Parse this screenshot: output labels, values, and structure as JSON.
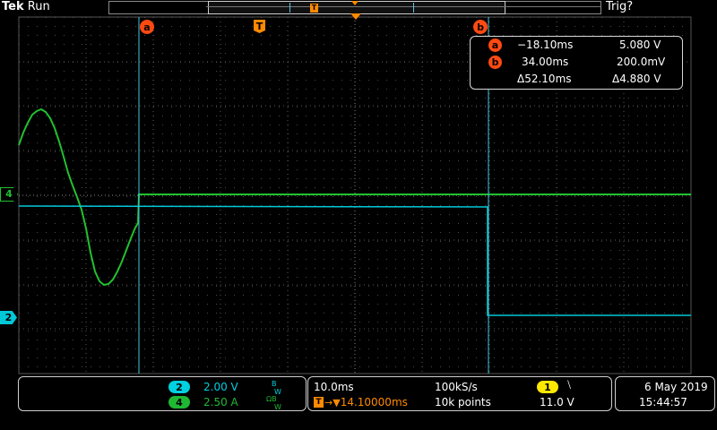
{
  "header": {
    "brand": "Tek",
    "status": "Run",
    "trigger_status": "Trig?"
  },
  "markers": {
    "cursor_a": "a",
    "cursor_b": "b",
    "trigger": "T",
    "channel4": "4",
    "channel2": "2"
  },
  "cursor_readout": {
    "a": {
      "label": "a",
      "time": "−18.10ms",
      "value": "5.080 V"
    },
    "b": {
      "label": "b",
      "time": "34.00ms",
      "value": "200.0mV"
    },
    "delta": {
      "time": "Δ52.10ms",
      "value": "Δ4.880 V"
    }
  },
  "channels": [
    {
      "number": "2",
      "scale": "2.00 V",
      "flag": "B",
      "flag_sub": "W",
      "color": "#00d0e0"
    },
    {
      "number": "4",
      "scale": "2.50 A",
      "flag": "ΩB",
      "flag_sub": "W",
      "color": "#1fb832"
    }
  ],
  "timebase": {
    "scale": "10.0ms",
    "sample_rate": "100kS/s",
    "trigger_position": "14.10000ms",
    "record_length": "10k points"
  },
  "trigger": {
    "source": "1",
    "slope_symbol": "⧵",
    "level": "11.0 V",
    "color": "#ffe800"
  },
  "datetime": {
    "date": "6 May 2019",
    "time": "15:44:57"
  },
  "colors": {
    "channel2": "#00c8d8",
    "channel4": "#22c030",
    "cursor": "#40c8e0",
    "cursor_marker": "#ff4a12",
    "trigger_marker": "#ff8a00",
    "grid": "#5a5a5a"
  }
}
